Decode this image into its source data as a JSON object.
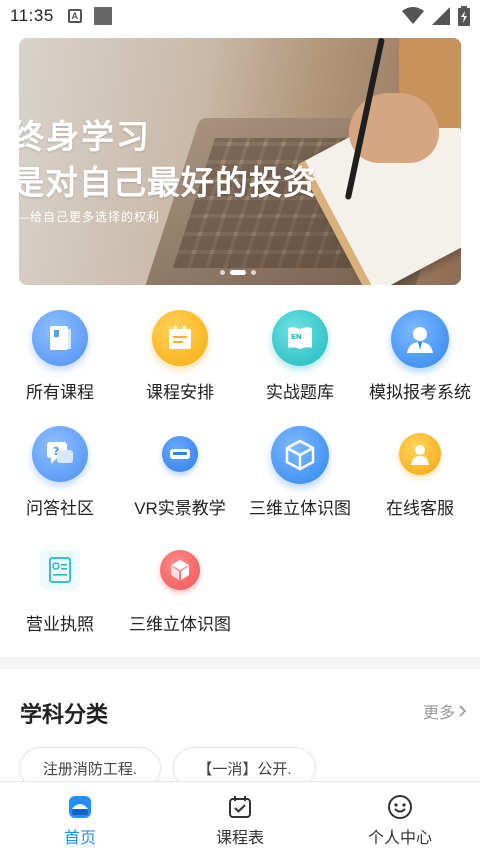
{
  "status_bar": {
    "time": "11:35",
    "a_icon": "A"
  },
  "banner": {
    "line1": "终身学习",
    "line2": "是对自己最好的投资",
    "subtitle": "—给自己更多选择的权利",
    "slides": 3,
    "active_slide": 2
  },
  "grid": {
    "items": [
      {
        "label": "所有课程",
        "icon": "book-icon",
        "color": "#5b9cf6"
      },
      {
        "label": "课程安排",
        "icon": "schedule-icon",
        "color": "#fcb717"
      },
      {
        "label": "实战题库",
        "icon": "en-book-icon",
        "color": "#2fc6c9"
      },
      {
        "label": "模拟报考系统",
        "icon": "user-profile-icon",
        "color": "#3d9af7"
      },
      {
        "label": "问答社区",
        "icon": "question-chat-icon",
        "color": "#5ea3f4"
      },
      {
        "label": "VR实景教学",
        "icon": "vr-headset-icon",
        "color": "#3d8ef0"
      },
      {
        "label": "三维立体识图",
        "icon": "cube-icon",
        "color": "#3b92ef"
      },
      {
        "label": "在线客服",
        "icon": "customer-service-icon",
        "color": "#f7b417"
      },
      {
        "label": "营业执照",
        "icon": "license-icon",
        "color": "#2ab7c8"
      },
      {
        "label": "三维立体识图",
        "icon": "red-cube-icon",
        "color": "#f06565"
      }
    ]
  },
  "subjects": {
    "title": "学科分类",
    "more": "更多",
    "tags": [
      "注册消防工程.",
      "【一消】公开."
    ]
  },
  "tab_bar": {
    "tabs": [
      {
        "label": "首页",
        "icon": "home-icon",
        "active": true
      },
      {
        "label": "课程表",
        "icon": "calendar-icon",
        "active": false
      },
      {
        "label": "个人中心",
        "icon": "smiley-icon",
        "active": false
      }
    ],
    "active_color": "#1e90ff"
  }
}
